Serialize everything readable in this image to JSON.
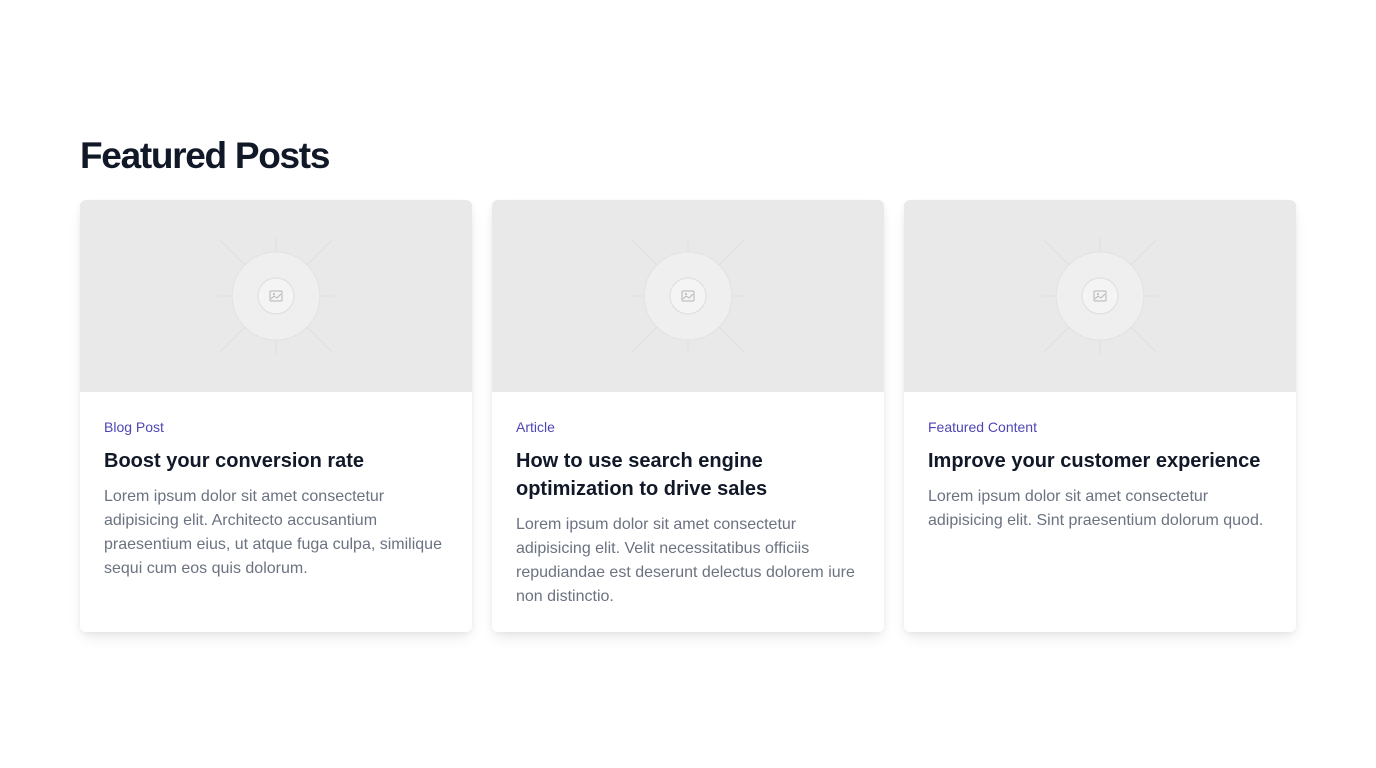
{
  "section": {
    "title": "Featured Posts"
  },
  "posts": [
    {
      "category": "Blog Post",
      "title": "Boost your conversion rate",
      "excerpt": "Lorem ipsum dolor sit amet consectetur adipisicing elit. Architecto accusantium praesentium eius, ut atque fuga culpa, similique sequi cum eos quis dolorum.",
      "image_icon": "image-placeholder-icon"
    },
    {
      "category": "Article",
      "title": "How to use search engine optimization to drive sales",
      "excerpt": "Lorem ipsum dolor sit amet consectetur adipisicing elit. Velit necessitatibus officiis repudiandae est deserunt delectus dolorem iure non distinctio.",
      "image_icon": "image-placeholder-icon"
    },
    {
      "category": "Featured Content",
      "title": "Improve your customer experience",
      "excerpt": "Lorem ipsum dolor sit amet consectetur adipisicing elit. Sint praesentium dolorum quod.",
      "image_icon": "image-placeholder-icon"
    }
  ],
  "colors": {
    "accent": "#4f46b5",
    "heading": "#111827",
    "body_text": "#6b7280",
    "image_bg": "#e9e9e9"
  }
}
